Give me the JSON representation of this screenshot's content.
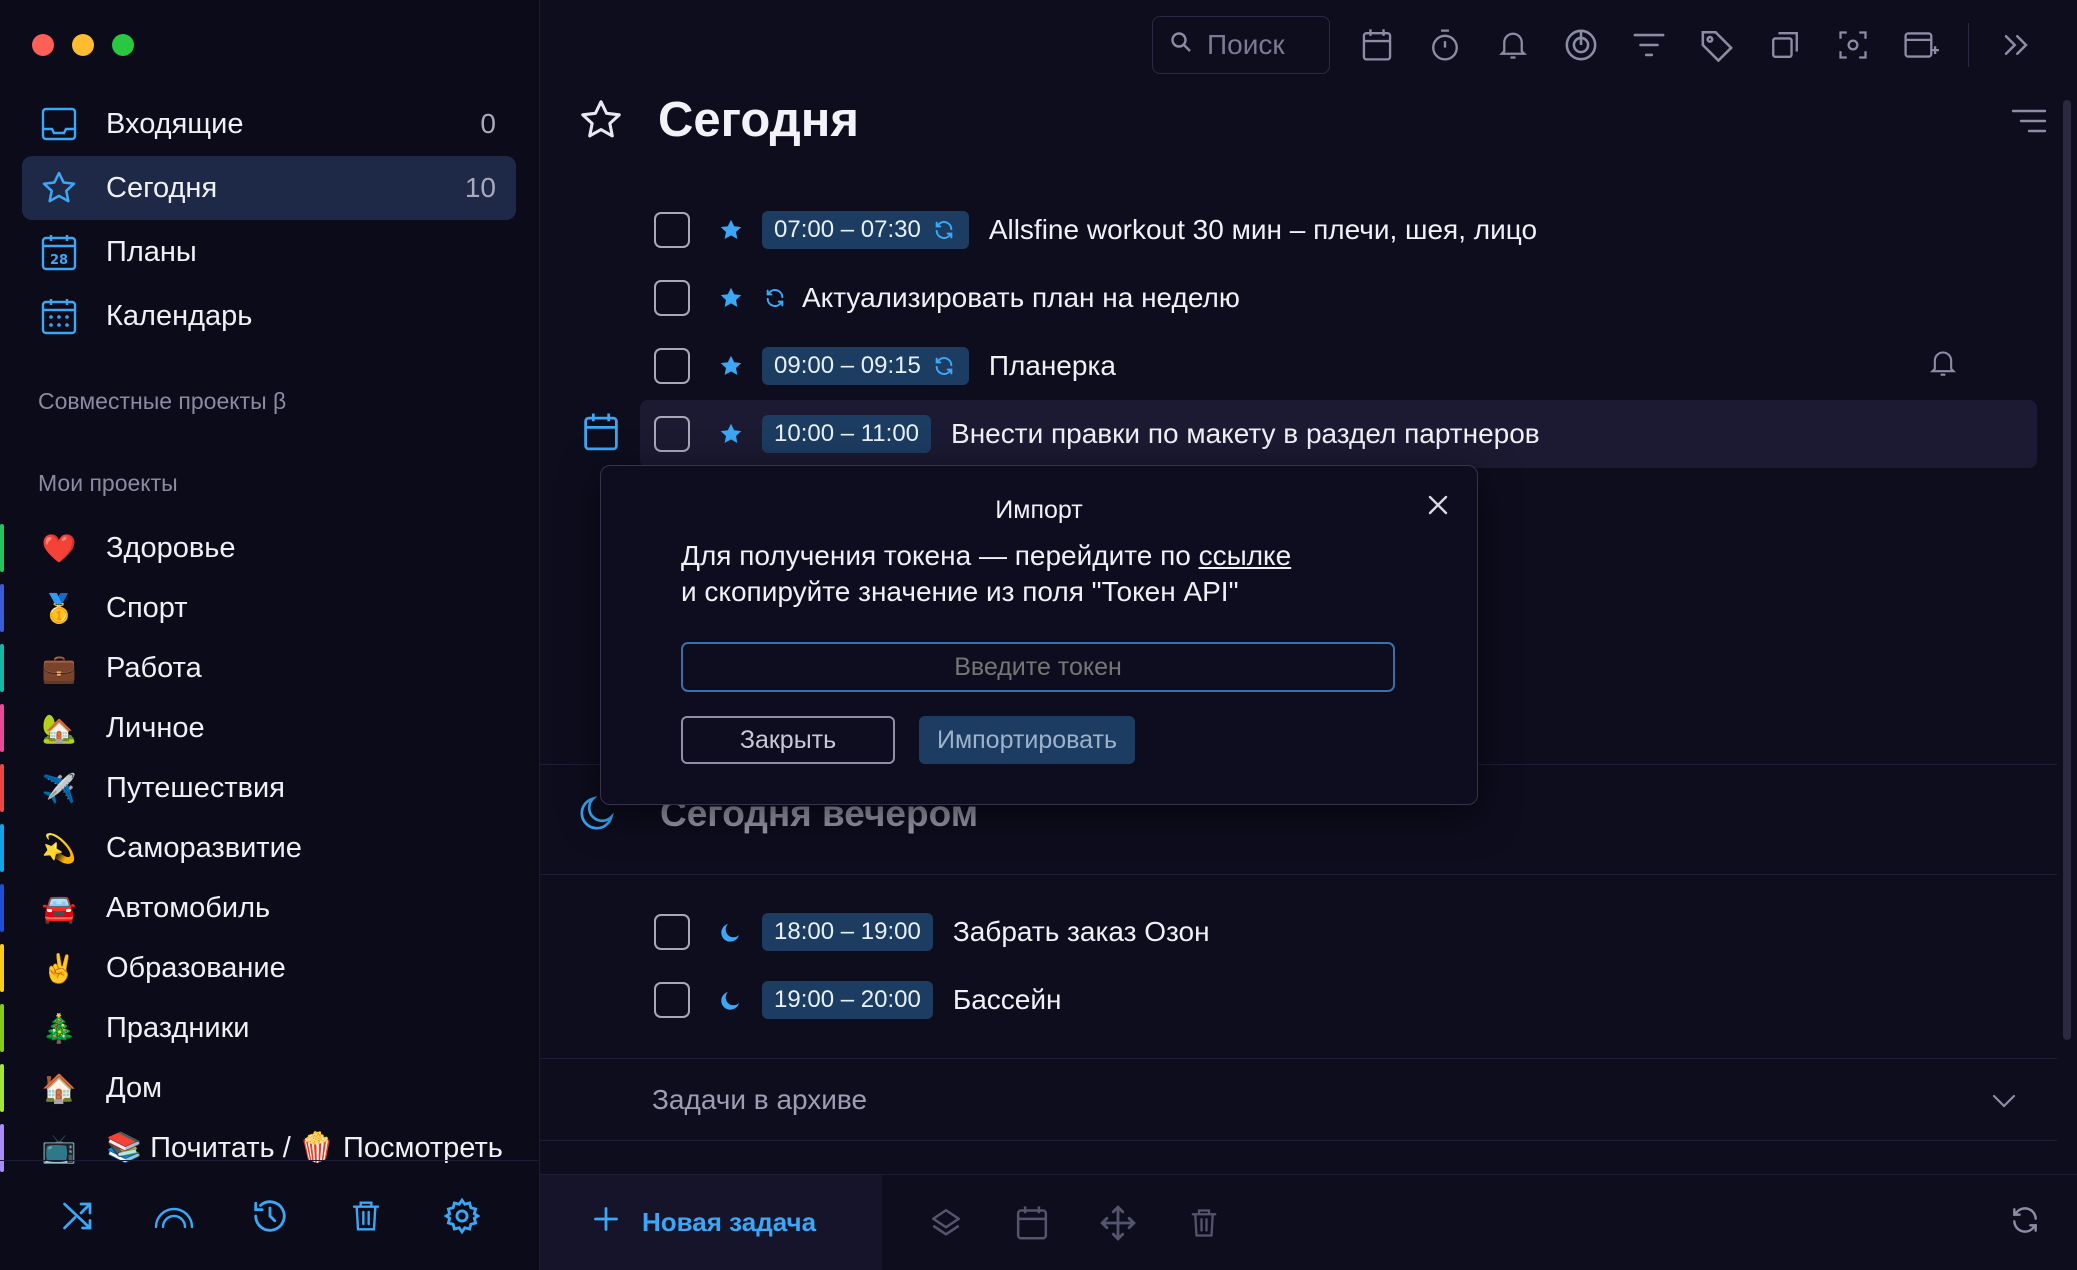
{
  "sidebar": {
    "nav": [
      {
        "label": "Входящие",
        "count": "0",
        "icon": "inbox-icon"
      },
      {
        "label": "Сегодня",
        "count": "10",
        "icon": "star-icon"
      },
      {
        "label": "Планы",
        "count": "",
        "icon": "calendar-28-icon"
      },
      {
        "label": "Календарь",
        "count": "",
        "icon": "calendar-grid-icon"
      }
    ],
    "shared_title": "Совместные проекты β",
    "projects_title": "Мои проекты",
    "projects": [
      {
        "label": "Здоровье",
        "emoji": "❤️",
        "color": "#22c55e"
      },
      {
        "label": "Спорт",
        "emoji": "🥇",
        "color": "#3b5bdb"
      },
      {
        "label": "Работа",
        "emoji": "💼",
        "color": "#14b8a6"
      },
      {
        "label": "Личное",
        "emoji": "🏡",
        "color": "#ec4899"
      },
      {
        "label": "Путешествия",
        "emoji": "✈️",
        "color": "#ef4444"
      },
      {
        "label": "Саморазвитие",
        "emoji": "💫",
        "color": "#0ea5e9"
      },
      {
        "label": "Автомобиль",
        "emoji": "🚘",
        "color": "#1d4ed8"
      },
      {
        "label": "Образование",
        "emoji": "✌️",
        "color": "#facc15"
      },
      {
        "label": "Праздники",
        "emoji": "🎄",
        "color": "#84cc16"
      },
      {
        "label": "Дом",
        "emoji": "🏠",
        "color": "#a3e635"
      },
      {
        "label": "📚 Почитать / 🍿 Посмотреть",
        "emoji": "📺",
        "color": "#a78bfa"
      }
    ]
  },
  "toolbar": {
    "search_placeholder": "Поиск"
  },
  "page": {
    "title": "Сегодня"
  },
  "tasks": [
    {
      "time": "07:00 – 07:30",
      "repeat": true,
      "title": "Allsfine workout 30 мин – плечи, шея, лицо"
    },
    {
      "time": "",
      "repeat": true,
      "title": "Актуализировать план на неделю"
    },
    {
      "time": "09:00 – 09:15",
      "repeat": true,
      "title": "Планерка",
      "bell": true
    },
    {
      "time": "10:00 – 11:00",
      "repeat": false,
      "title": "Внести правки по макету в раздел партнеров"
    }
  ],
  "evening": {
    "title": "Сегодня вечером",
    "tasks": [
      {
        "time": "18:00 – 19:00",
        "title": "Забрать заказ Озон"
      },
      {
        "time": "19:00 – 20:00",
        "title": "Бассейн"
      }
    ]
  },
  "archive_label": "Задачи в архиве",
  "bottom": {
    "new_task": "Новая задача"
  },
  "modal": {
    "title": "Импорт",
    "text_before_link": "Для получения токена — перейдите по ",
    "link_text": "ссылке",
    "text_line2": "и скопируйте значение из поля \"Токен API\"",
    "input_placeholder": "Введите токен",
    "close_label": "Закрыть",
    "import_label": "Импортировать"
  },
  "colors": {
    "accent": "#3ba7f5",
    "chip": "#1d3c61",
    "bg": "#0e0d1e"
  }
}
